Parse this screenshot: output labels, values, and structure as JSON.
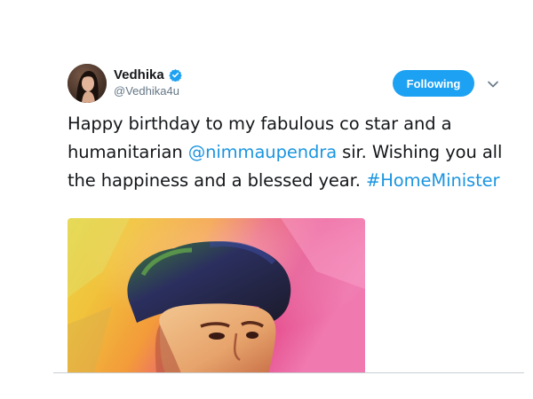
{
  "user": {
    "display_name": "Vedhika",
    "handle": "@Vedhika4u",
    "verified_icon": "verified-badge-icon",
    "avatar": "profile-photo"
  },
  "follow_button": {
    "label": "Following"
  },
  "more_menu_icon": "chevron-down-icon",
  "tweet": {
    "text_part1": "Happy birthday to my fabulous co star and a humanitarian ",
    "mention": "@nimmaupendra",
    "text_part2": " sir. Wishing you all the happiness and a blessed year. ",
    "hashtag": "#HomeMinister"
  },
  "media": {
    "kind": "painted portrait artwork"
  },
  "colors": {
    "accent": "#1da1f2",
    "link": "#1b95e0",
    "text": "#14171a",
    "secondary": "#657786"
  }
}
